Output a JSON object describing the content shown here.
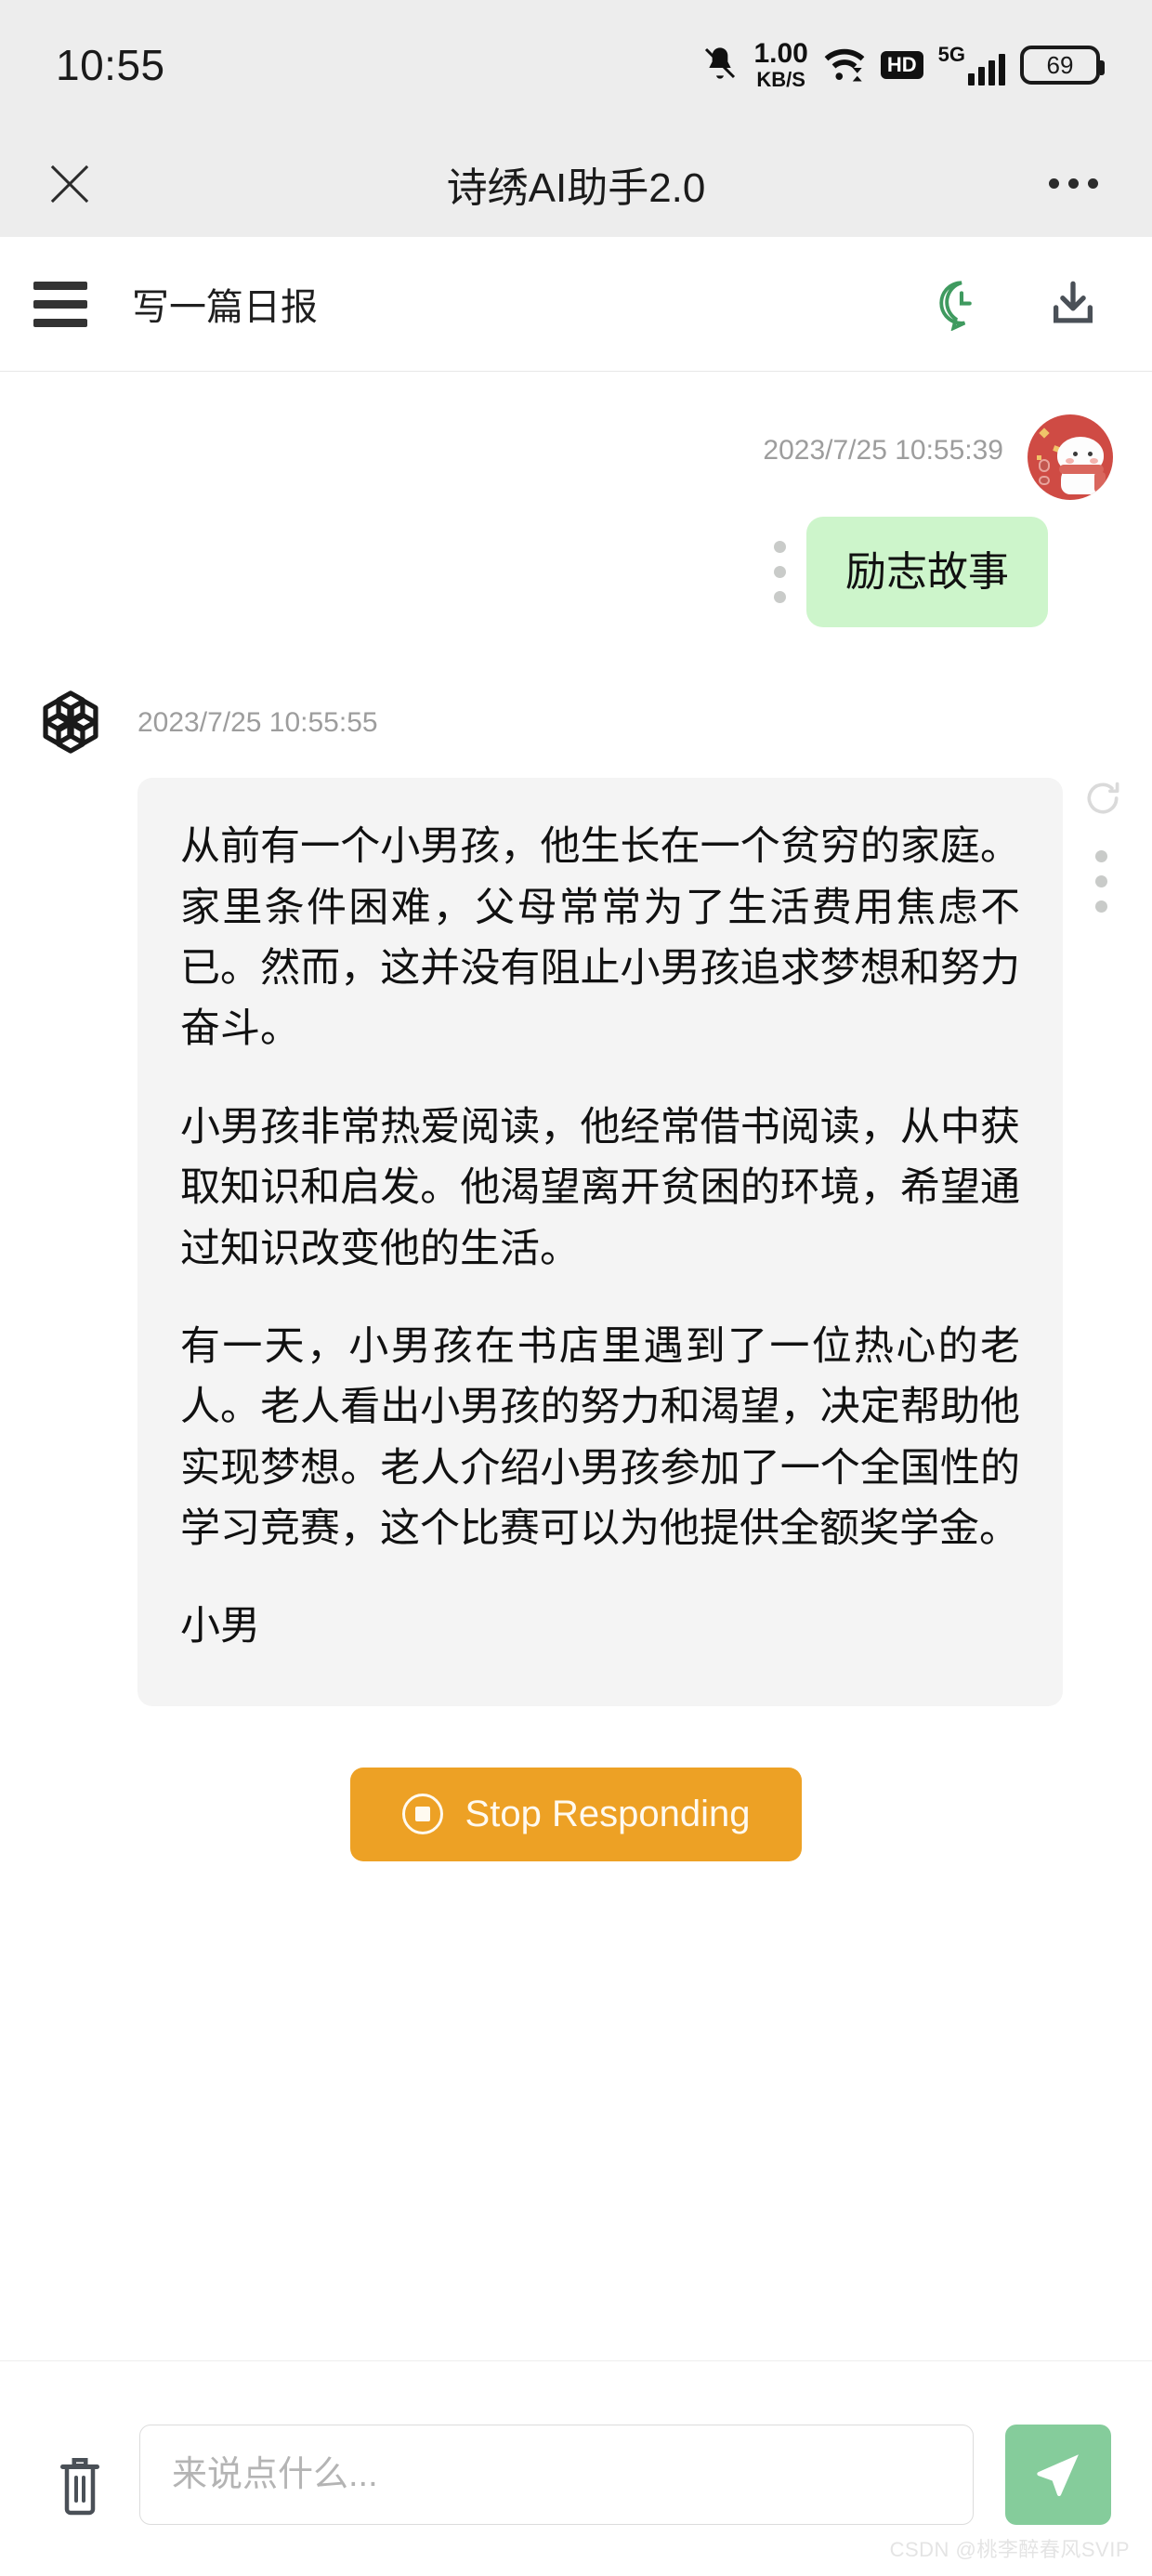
{
  "statusbar": {
    "time": "10:55",
    "net_speed_value": "1.00",
    "net_speed_unit": "KB/S",
    "hd_label": "HD",
    "network_type": "5G",
    "battery_level": "69",
    "icons": [
      "bell-muted-icon",
      "wifi-icon",
      "hd-icon",
      "signal-icon",
      "battery-icon"
    ]
  },
  "titlebar": {
    "close_label": "close-icon",
    "title": "诗绣AI助手2.0",
    "more_label": "more-icon"
  },
  "toolbar": {
    "menu_label": "menu-icon",
    "conversation_title": "写一篇日报",
    "history_icon": "chat-history-icon",
    "download_icon": "download-icon",
    "accent_green": "#3f9a5f"
  },
  "chat": {
    "user_message": {
      "timestamp": "2023/7/25 10:55:39",
      "text": "励志故事",
      "bubble_color": "#cdf5cb",
      "avatar": "user-avatar"
    },
    "ai_message": {
      "timestamp": "2023/7/25 10:55:55",
      "avatar": "openai-logo-icon",
      "bubble_color": "#f4f4f4",
      "paragraphs": [
        "从前有一个小男孩，他生长在一个贫穷的家庭。家里条件困难，父母常常为了生活费用焦虑不已。然而，这并没有阻止小男孩追求梦想和努力奋斗。",
        "小男孩非常热爱阅读，他经常借书阅读，从中获取知识和启发。他渴望离开贫困的环境，希望通过知识改变他的生活。",
        "有一天，小男孩在书店里遇到了一位热心的老人。老人看出小男孩的努力和渴望，决定帮助他实现梦想。老人介绍小男孩参加了一个全国性的学习竞赛，这个比赛可以为他提供全额奖学金。",
        "小男"
      ],
      "regenerate_icon": "regenerate-icon",
      "more_icon": "more-vertical-icon"
    }
  },
  "stop_button": {
    "label": "Stop Responding",
    "color": "#eda125",
    "icon": "stop-circle-icon"
  },
  "input_bar": {
    "clear_icon": "trash-icon",
    "placeholder": "来说点什么...",
    "value": "",
    "send_icon": "send-icon",
    "send_color": "#85cc9b"
  },
  "watermark": {
    "text": "CSDN @桃李醉春风SVIP"
  }
}
